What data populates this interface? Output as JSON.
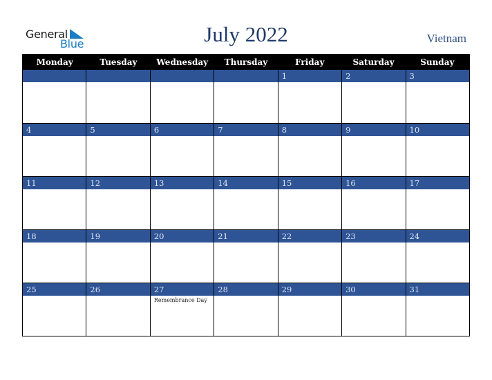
{
  "logo": {
    "general": "General",
    "blue": "Blue"
  },
  "title": "July 2022",
  "country": "Vietnam",
  "weekdays": [
    "Monday",
    "Tuesday",
    "Wednesday",
    "Thursday",
    "Friday",
    "Saturday",
    "Sunday"
  ],
  "weeks": [
    [
      {
        "day": ""
      },
      {
        "day": ""
      },
      {
        "day": ""
      },
      {
        "day": ""
      },
      {
        "day": "1"
      },
      {
        "day": "2"
      },
      {
        "day": "3"
      }
    ],
    [
      {
        "day": "4"
      },
      {
        "day": "5"
      },
      {
        "day": "6"
      },
      {
        "day": "7"
      },
      {
        "day": "8"
      },
      {
        "day": "9"
      },
      {
        "day": "10"
      }
    ],
    [
      {
        "day": "11"
      },
      {
        "day": "12"
      },
      {
        "day": "13"
      },
      {
        "day": "14"
      },
      {
        "day": "15"
      },
      {
        "day": "16"
      },
      {
        "day": "17"
      }
    ],
    [
      {
        "day": "18"
      },
      {
        "day": "19"
      },
      {
        "day": "20"
      },
      {
        "day": "21"
      },
      {
        "day": "22"
      },
      {
        "day": "23"
      },
      {
        "day": "24"
      }
    ],
    [
      {
        "day": "25"
      },
      {
        "day": "26"
      },
      {
        "day": "27",
        "event": "Remembrance Day"
      },
      {
        "day": "28"
      },
      {
        "day": "29"
      },
      {
        "day": "30"
      },
      {
        "day": "31"
      }
    ]
  ],
  "colors": {
    "header_bg": "#000000",
    "day_bar": "#2e5496",
    "title": "#1f3a68",
    "logo_blue": "#1b7dc4"
  }
}
